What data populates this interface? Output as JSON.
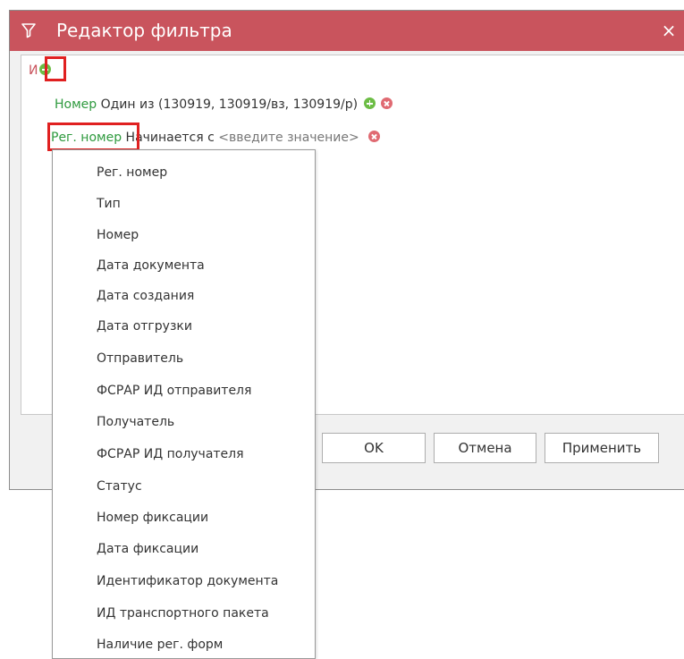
{
  "dialog": {
    "title": "Редактор фильтра",
    "close_label": "×"
  },
  "filter": {
    "group_operator": "И",
    "conditions": [
      {
        "field": "Номер",
        "operator": "Один из (130919, 130919/вз, 130919/р)"
      },
      {
        "field": "Рег. номер",
        "operator": "Начинается с",
        "value_placeholder": "<введите значение>"
      }
    ]
  },
  "buttons": {
    "ok": "OK",
    "cancel": "Отмена",
    "apply": "Применить"
  },
  "dropdown": {
    "items": [
      "Рег. номер",
      "Тип",
      "Номер",
      "Дата документа",
      "Дата создания",
      "Дата отгрузки",
      "Отправитель",
      "ФСРАР ИД отправителя",
      "Получатель",
      "ФСРАР ИД получателя",
      "Статус",
      "Номер фиксации",
      "Дата фиксации",
      "Идентификатор документа",
      "ИД транспортного пакета",
      "Наличие рег. форм"
    ]
  },
  "colors": {
    "titlebar": "#c9545d",
    "field_green": "#2e9a3e",
    "add_icon": "#6cbd45",
    "remove_icon": "#e06a72",
    "highlight": "#e02020"
  },
  "icons": {
    "title": "filter-icon",
    "add": "plus-circle-icon",
    "remove": "close-circle-icon",
    "close": "close-icon"
  }
}
